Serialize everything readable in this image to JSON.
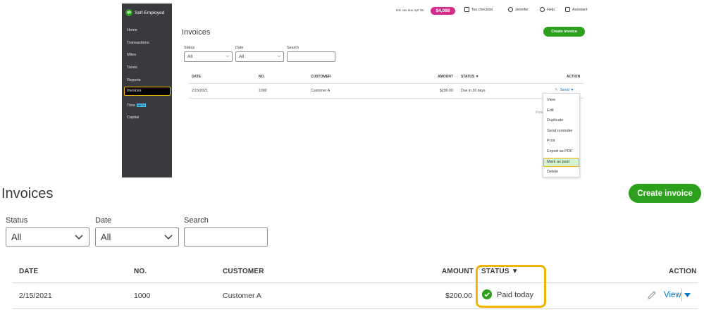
{
  "top": {
    "brand": "Self-Employed",
    "brand_logo": "qb",
    "sidebar": [
      "Home",
      "Transactions",
      "Miles",
      "Taxes",
      "Reports",
      "Invoices",
      "Time",
      "Capital"
    ],
    "beta": "BETA",
    "topbar": {
      "est_tax": "Est. tax due Apr 15:",
      "tax_amount": "$4,088",
      "checklist": "Tax checklist",
      "user": "Jennifer",
      "help": "Help",
      "assistant": "Assistant"
    },
    "page_title": "Invoices",
    "create_label": "Create invoice",
    "filters": {
      "status_label": "Status",
      "status_value": "All",
      "date_label": "Date",
      "date_value": "All",
      "search_label": "Search"
    },
    "headers": [
      "DATE",
      "NO.",
      "CUSTOMER",
      "AMOUNT",
      "STATUS ▼",
      "ACTION"
    ],
    "row": {
      "date": "2/15/2021",
      "no": "1000",
      "customer": "Customer A",
      "amount": "$200.00",
      "status": "Due in 30 days",
      "send": "Send"
    },
    "pager": {
      "prev": "Prev",
      "next": "t"
    },
    "menu": [
      "View",
      "Edit",
      "Duplicate",
      "Send reminder",
      "Print",
      "Export as PDF",
      "Mark as paid",
      "Delete"
    ]
  },
  "bottom": {
    "page_title": "Invoices",
    "create_label": "Create invoice",
    "filters": {
      "status_label": "Status",
      "status_value": "All",
      "date_label": "Date",
      "date_value": "All",
      "search_label": "Search",
      "search_value": ""
    },
    "headers": [
      "DATE",
      "NO.",
      "CUSTOMER",
      "AMOUNT",
      "STATUS ▼",
      "ACTION"
    ],
    "row": {
      "date": "2/15/2021",
      "no": "1000",
      "customer": "Customer A",
      "amount": "$200.00",
      "status": "Paid today",
      "view": "View"
    }
  },
  "colors": {
    "sidebar": "#393a3d",
    "green": "#2ca01c",
    "highlight": "#f2b300",
    "link": "#0077c5",
    "tax_pill": "#d52b8b"
  }
}
